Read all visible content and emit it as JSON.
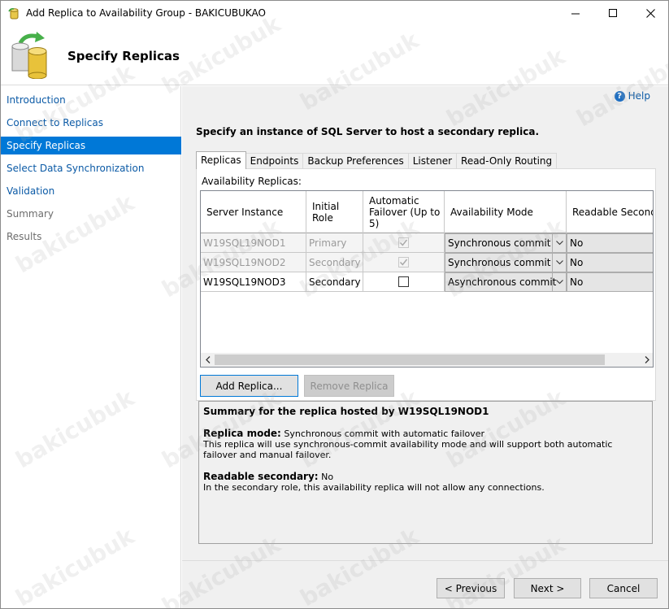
{
  "window": {
    "title": "Add Replica to Availability Group - BAKICUBUKAO",
    "minimize_glyph": "—",
    "maximize_glyph": "☐",
    "close_glyph": "✕"
  },
  "header": {
    "title": "Specify Replicas"
  },
  "nav": {
    "items": [
      {
        "label": "Introduction",
        "state": "link"
      },
      {
        "label": "Connect to Replicas",
        "state": "link"
      },
      {
        "label": "Specify Replicas",
        "state": "selected"
      },
      {
        "label": "Select Data Synchronization",
        "state": "link"
      },
      {
        "label": "Validation",
        "state": "link"
      },
      {
        "label": "Summary",
        "state": "disabled"
      },
      {
        "label": "Results",
        "state": "disabled"
      }
    ]
  },
  "help": {
    "label": "Help",
    "icon": "help-icon"
  },
  "instruction": "Specify an instance of SQL Server to host a secondary replica.",
  "tabs": [
    {
      "label": "Replicas",
      "active": true
    },
    {
      "label": "Endpoints",
      "active": false
    },
    {
      "label": "Backup Preferences",
      "active": false
    },
    {
      "label": "Listener",
      "active": false
    },
    {
      "label": "Read-Only Routing",
      "active": false
    }
  ],
  "replicas_panel": {
    "label": "Availability Replicas:",
    "columns": [
      "Server Instance",
      "Initial Role",
      "Automatic Failover (Up to 5)",
      "Availability Mode",
      "Readable Secondar"
    ],
    "rows": [
      {
        "server": "W19SQL19NOD1",
        "role": "Primary",
        "failover": true,
        "mode": "Synchronous commit",
        "readable": "No",
        "dimmed": true
      },
      {
        "server": "W19SQL19NOD2",
        "role": "Secondary",
        "failover": true,
        "mode": "Synchronous commit",
        "readable": "No",
        "dimmed": true
      },
      {
        "server": "W19SQL19NOD3",
        "role": "Secondary",
        "failover": false,
        "mode": "Asynchronous commit",
        "readable": "No",
        "dimmed": false
      }
    ],
    "add_button": "Add Replica...",
    "remove_button": "Remove Replica"
  },
  "summary": {
    "title_prefix": "Summary for the replica hosted by ",
    "title_server": "W19SQL19NOD1",
    "mode_label": "Replica mode:",
    "mode_value": " Synchronous commit with automatic failover",
    "mode_desc": "This replica will use synchronous-commit availability mode and will support both automatic failover and manual failover.",
    "readable_label": "Readable secondary:",
    "readable_value": " No",
    "readable_desc": "In the secondary role, this availability replica will not allow any connections."
  },
  "footer": {
    "previous": "< Previous",
    "next": "Next >",
    "cancel": "Cancel"
  },
  "watermark_text": "bakicubuk"
}
